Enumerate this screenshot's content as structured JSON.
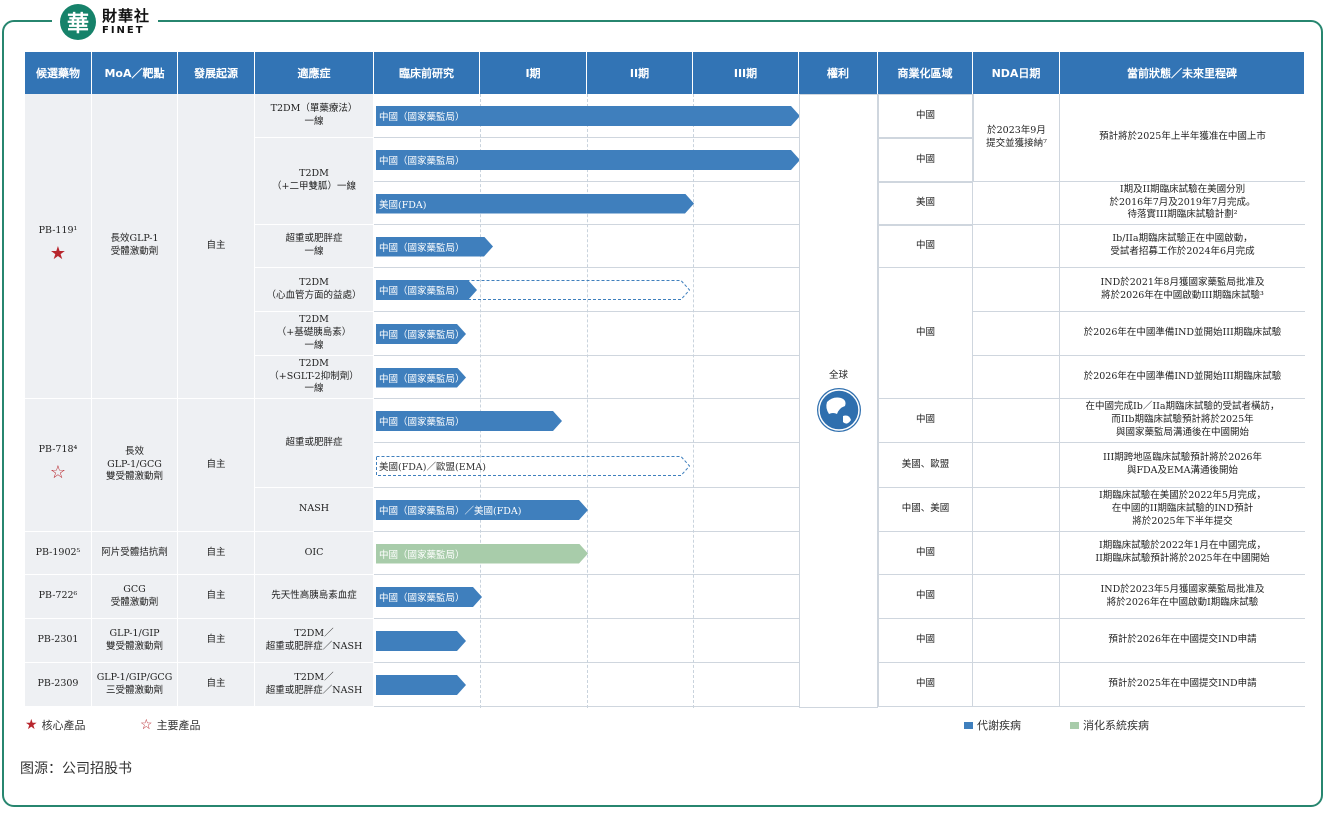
{
  "brand": {
    "logo_char": "華",
    "name_cn": "財華社",
    "name_en": "FINET"
  },
  "watermark": {
    "cn": "財華社",
    "en": "FINET"
  },
  "headers": [
    "候選藥物",
    "MoA／靶點",
    "發展起源",
    "適應症",
    "臨床前研究",
    "I期",
    "II期",
    "III期",
    "權利",
    "商業化區域",
    "NDA日期",
    "當前狀態／未來里程碑"
  ],
  "drugs": [
    {
      "name": "PB-119¹",
      "moa": "長效GLP-1\n受體激動劑",
      "origin": "自主",
      "star": "filled"
    },
    {
      "name": "PB-718⁴",
      "moa": "長效\nGLP-1/GCG\n雙受體激動劑",
      "origin": "自主",
      "star": "outline"
    },
    {
      "name": "PB-1902⁵",
      "moa": "阿片受體拮抗劑",
      "origin": "自主"
    },
    {
      "name": "PB-722⁶",
      "moa": "GCG\n受體激動劑",
      "origin": "自主"
    },
    {
      "name": "PB-2301",
      "moa": "GLP-1/GIP\n雙受體激動劑",
      "origin": "自主"
    },
    {
      "name": "PB-2309",
      "moa": "GLP-1/GIP/GCG\n三受體激動劑",
      "origin": "自主"
    }
  ],
  "indications": [
    "T2DM（單藥療法）\n一線",
    "T2DM\n（+二甲雙胍）一線",
    "超重或肥胖症\n一線",
    "T2DM\n（心血管方面的益處）",
    "T2DM\n（+基礎胰島素）\n一線",
    "T2DM\n（+SGLT-2抑制劑）\n一線",
    "超重或肥胖症",
    "NASH",
    "OIC",
    "先天性高胰島素血症",
    "T2DM／\n超重或肥胖症／NASH",
    "T2DM／\n超重或肥胖症／NASH"
  ],
  "bars": [
    {
      "label": "中國（國家藥監局）",
      "style": "solid",
      "stage": 4.0
    },
    {
      "label": "中國（國家藥監局）",
      "style": "solid",
      "stage": 4.0
    },
    {
      "label": "美國(FDA)",
      "style": "solid",
      "stage": 3.0
    },
    {
      "label": "中國（國家藥監局）",
      "style": "solid",
      "stage": 1.1
    },
    {
      "label": "中國（國家藥監局）",
      "style": "dash",
      "stage": 0.95,
      "planned": 3.0
    },
    {
      "label": "中國（國家藥監局）",
      "style": "solid",
      "stage": 0.85
    },
    {
      "label": "中國（國家藥監局）",
      "style": "solid",
      "stage": 0.85
    },
    {
      "label": "中國（國家藥監局）",
      "style": "solid",
      "stage": 1.75
    },
    {
      "label": "美國(FDA)／歐盟(EMA)",
      "style": "dash",
      "stage": 0,
      "planned": 3.0
    },
    {
      "label": "中國（國家藥監局）／美國(FDA)",
      "style": "solid",
      "stage": 2.0
    },
    {
      "label": "中國（國家藥監局）",
      "style": "green",
      "stage": 2.0
    },
    {
      "label": "中國（國家藥監局）",
      "style": "solid",
      "stage": 1.0
    },
    {
      "label": "",
      "style": "solid",
      "stage": 0.85
    },
    {
      "label": "",
      "style": "solid",
      "stage": 0.85
    }
  ],
  "rights": "全球",
  "regions": [
    "中國",
    "中國",
    "美國",
    "中國",
    "中國",
    "中國",
    "美國、歐盟",
    "中國、美國",
    "中國",
    "中國",
    "中國",
    "中國"
  ],
  "nda": "於2023年9月\n提交並獲接納⁷",
  "statuses": [
    "預計將於2025年上半年獲准在中國上市",
    "I期及II期臨床試驗在美國分別\n於2016年7月及2019年7月完成。\n待落實III期臨床試驗計劃²",
    "Ib/IIa期臨床試驗正在中國啟動，\n受試者招募工作於2024年6月完成",
    "IND於2021年8月獲國家藥監局批准及\n將於2026年在中國啟動III期臨床試驗³",
    "於2026年在中國準備IND並開始III期臨床試驗",
    "於2026年在中國準備IND並開始III期臨床試驗",
    "在中國完成Ib／IIa期臨床試驗的受試者橫訪，\n而IIb期臨床試驗預計將於2025年\n與國家藥監局溝通後在中國開始",
    "III期跨地區臨床試驗預計將於2026年\n與FDA及EMA溝通後開始",
    "I期臨床試驗在美國於2022年5月完成，\n在中國的II期臨床試驗的IND預計\n將於2025年下半年提交",
    "I期臨床試驗於2022年1月在中國完成，\nII期臨床試驗預計將於2025年在中國開始",
    "IND於2023年5月獲國家藥監局批准及\n將於2026年在中國啟動I期臨床試驗",
    "預計於2026年在中國提交IND申請",
    "預計於2025年在中國提交IND申請"
  ],
  "legend": {
    "core": "核心產品",
    "key": "主要產品",
    "metabolic": "代謝疾病",
    "digestive": "消化系統疾病",
    "metabolic_color": "#3f7fbd",
    "digestive_color": "#a8ccaa"
  },
  "source": "图源：公司招股书"
}
